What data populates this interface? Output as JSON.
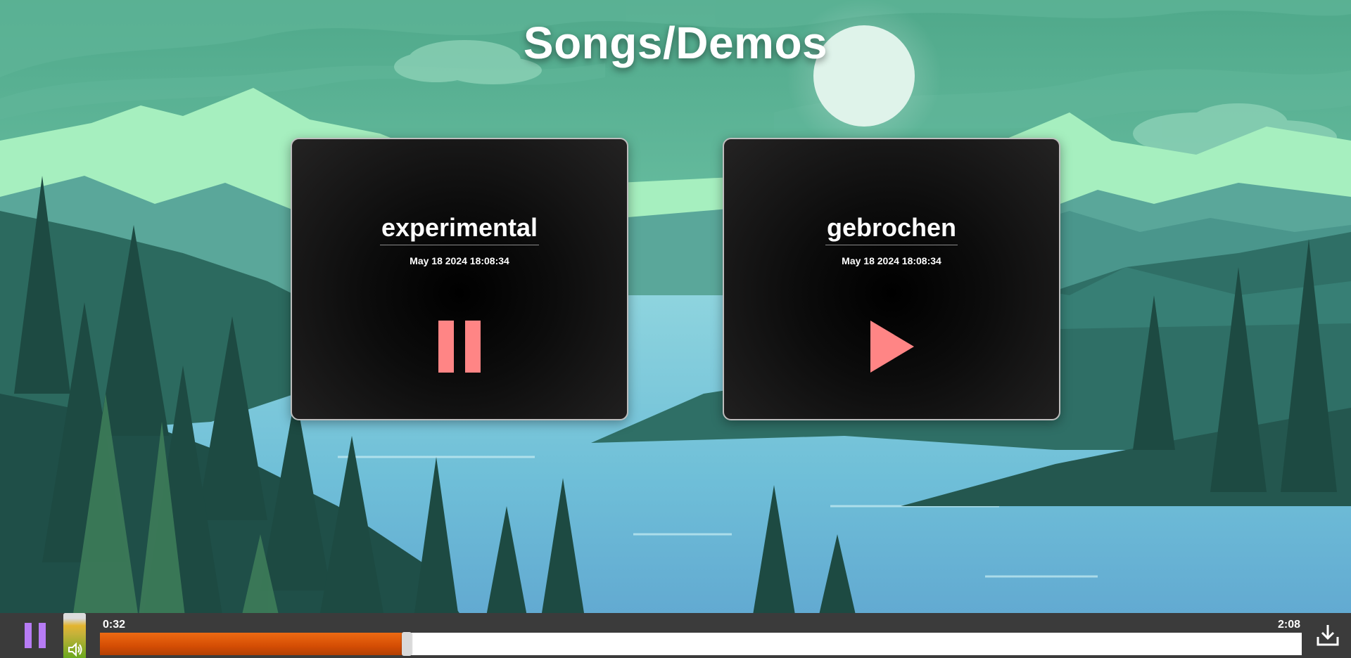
{
  "header": {
    "title": "Songs/Demos"
  },
  "songs": [
    {
      "title": "experimental",
      "date": "May 18 2024 18:08:34",
      "state": "playing",
      "icon": "pause-icon"
    },
    {
      "title": "gebrochen",
      "date": "May 18 2024 18:08:34",
      "state": "paused",
      "icon": "play-icon"
    }
  ],
  "player": {
    "current_time": "0:32",
    "total_time": "2:08",
    "progress_fraction": 0.255,
    "volume_fraction": 1.0,
    "play_pause_icon": "pause-icon",
    "volume_icon": "speaker-icon",
    "download_icon": "download-icon"
  },
  "colors": {
    "icon_accent": "#ff8585",
    "player_pause_accent": "#b77cf5",
    "progress_fill": "#d44d04",
    "player_bar_bg": "#3b3b3b"
  }
}
